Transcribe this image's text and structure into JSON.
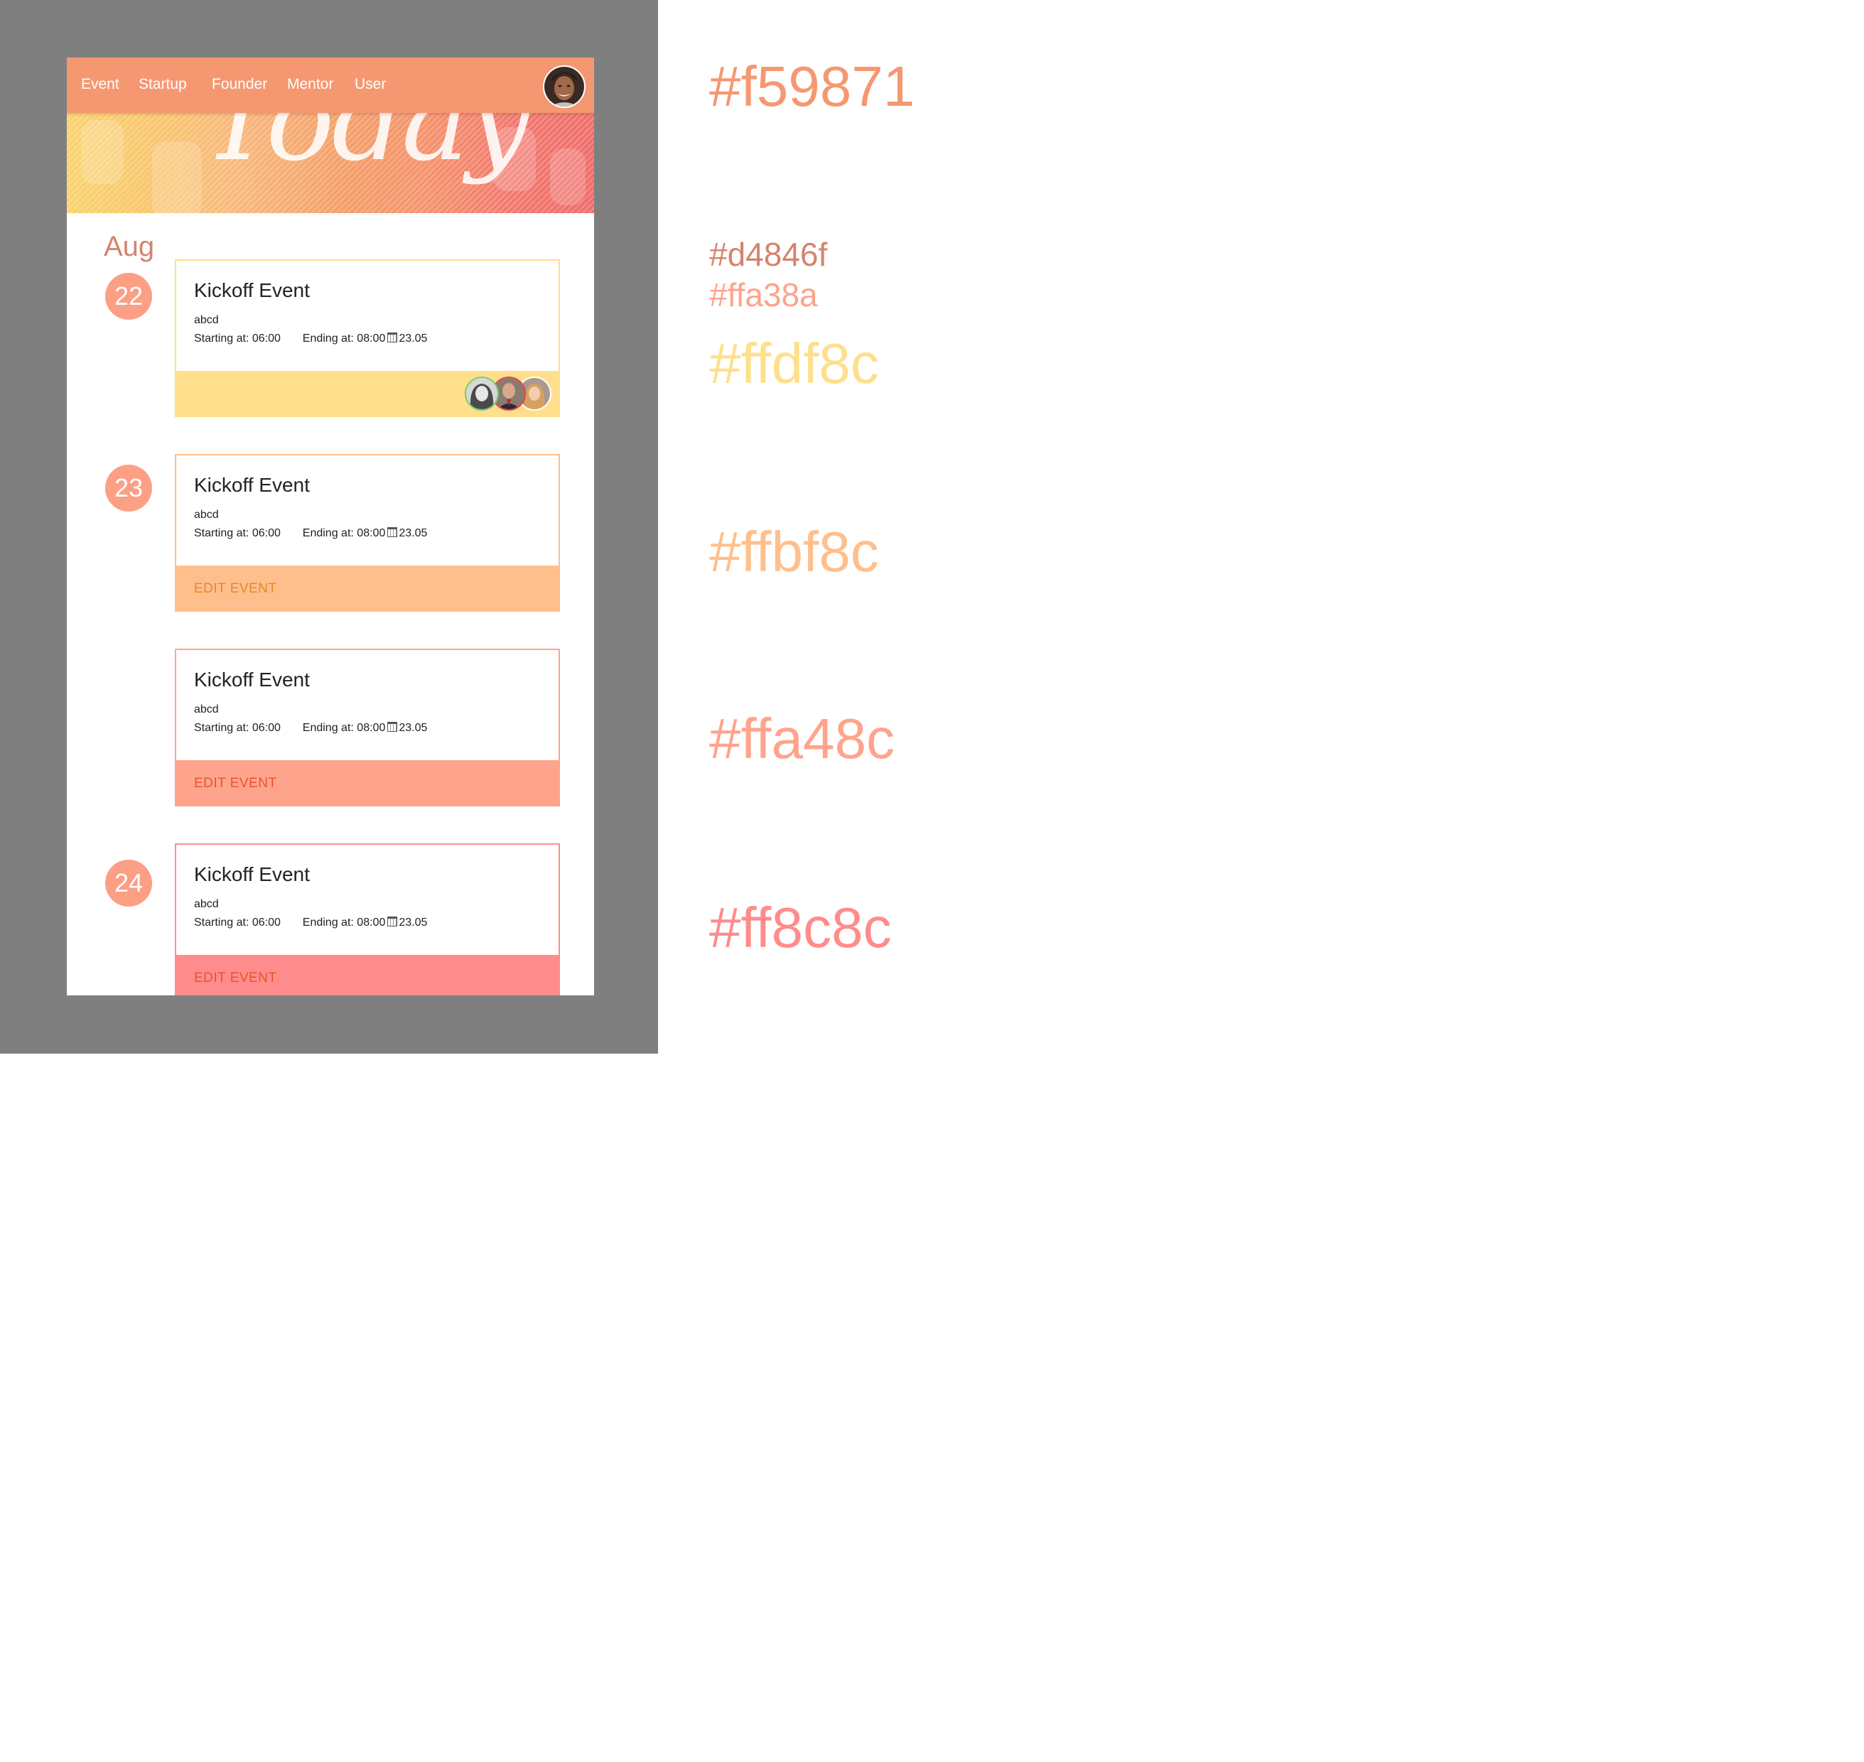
{
  "nav": {
    "items": [
      "Event",
      "Startup",
      "Founder",
      "Mentor",
      "User"
    ]
  },
  "hero": {
    "word": "Today"
  },
  "timeline": {
    "month": "Aug",
    "days": [
      "22",
      "23",
      "24"
    ]
  },
  "events": [
    {
      "title": "Kickoff Event",
      "description": "abcd",
      "start_label": "Starting at:",
      "start_time": "06:00",
      "end_label": "Ending at:",
      "end_time": "08:00",
      "date": "23.05",
      "footer": "avatars",
      "border_color": "#ffdf8c",
      "footer_color": "#ffdf8c"
    },
    {
      "title": "Kickoff Event",
      "description": "abcd",
      "start_label": "Starting at:",
      "start_time": "06:00",
      "end_label": "Ending at:",
      "end_time": "08:00",
      "date": "23.05",
      "action": "EDIT EVENT",
      "border_color": "#ffbf8c",
      "footer_color": "#ffbf8c"
    },
    {
      "title": "Kickoff Event",
      "description": "abcd",
      "start_label": "Starting at:",
      "start_time": "06:00",
      "end_label": "Ending at:",
      "end_time": "08:00",
      "date": "23.05",
      "action": "EDIT EVENT",
      "border_color": "#ffa48c",
      "footer_color": "#ffa48c"
    },
    {
      "title": "Kickoff Event",
      "description": "abcd",
      "start_label": "Starting at:",
      "start_time": "06:00",
      "end_label": "Ending at:",
      "end_time": "08:00",
      "date": "23.05",
      "action": "EDIT EVENT",
      "border_color": "#ff8c8c",
      "footer_color": "#ff8c8c"
    }
  ],
  "palette": [
    "#f59871",
    "#d4846f",
    "#ffa38a",
    "#ffdf8c",
    "#ffbf8c",
    "#ffa48c",
    "#ff8c8c"
  ],
  "colors": {
    "page_background": "#7f7f7f",
    "navbar": "#f59871",
    "month_text": "#d4846f",
    "day_badge": "#fc9f84",
    "edit_text_orange": "#e5892f",
    "edit_text_red": "#e8532e"
  }
}
